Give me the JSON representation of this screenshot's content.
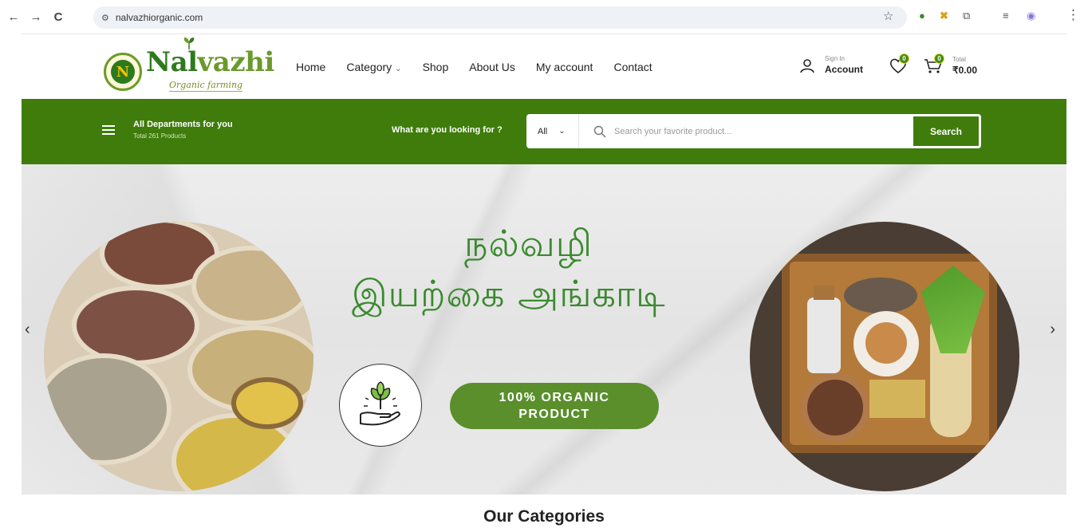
{
  "browser": {
    "url": "nalvazhiorganic.com",
    "back": "←",
    "forward": "→",
    "reload": "C"
  },
  "logo": {
    "name_part1": "Nal",
    "name_part2": "vazhi",
    "tagline": "Organic farming"
  },
  "nav": {
    "items": [
      "Home",
      "Category",
      "Shop",
      "About Us",
      "My account",
      "Contact"
    ]
  },
  "account": {
    "small": "Sign In",
    "big": "Account"
  },
  "wishlist": {
    "count": "0"
  },
  "cart": {
    "count": "0",
    "small": "Total",
    "big": "₹0.00"
  },
  "departments": {
    "title": "All Departments for you",
    "subtitle": "Total 261 Products"
  },
  "search": {
    "prompt": "What are you looking for ?",
    "category": "All",
    "placeholder": "Search your favorite product...",
    "button": "Search"
  },
  "hero": {
    "line1": "நல்வழி",
    "line2": "இயற்கை அங்காடி",
    "badge": "100% ORGANIC PRODUCT",
    "prev": "‹",
    "next": "›"
  },
  "section": {
    "title": "Our Categories"
  },
  "colors": {
    "brand_green": "#3f7c0b",
    "accent_green": "#5a8f2c",
    "tamil_green": "#3a8a2e"
  }
}
